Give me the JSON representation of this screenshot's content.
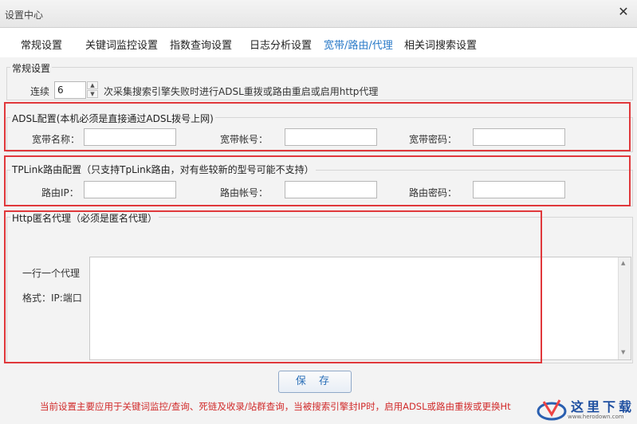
{
  "window": {
    "title": "设置中心",
    "close_icon": "close-icon"
  },
  "tabs": [
    {
      "label": "常规设置"
    },
    {
      "label": "关键词监控设置"
    },
    {
      "label": "指数查询设置"
    },
    {
      "label": "日志分析设置"
    },
    {
      "label": "宽带/路由/代理",
      "active": true
    },
    {
      "label": "相关词搜索设置"
    }
  ],
  "general": {
    "legend": "常规设置",
    "prefix": "连续",
    "count": "6",
    "suffix": "次采集搜索引擎失败时进行ADSL重拨或路由重启或启用http代理"
  },
  "adsl": {
    "legend": "ADSL配置(本机必须是直接通过ADSL拨号上网)",
    "name_label": "宽带名称：",
    "account_label": "宽带帐号：",
    "password_label": "宽带密码：",
    "name_value": "",
    "account_value": "",
    "password_value": ""
  },
  "router": {
    "legend": "TPLink路由配置（只支持TpLink路由，对有些较新的型号可能不支持）",
    "ip_label": "路由IP：",
    "account_label": "路由帐号：",
    "password_label": "路由密码：",
    "ip_value": "",
    "account_value": "",
    "password_value": ""
  },
  "proxy": {
    "legend": "Http匿名代理（必须是匿名代理）",
    "hint1": "一行一个代理",
    "hint2": "格式：IP:端口",
    "value": ""
  },
  "actions": {
    "save_label": "保 存"
  },
  "footer_note": "当前设置主要应用于关键词监控/查询、死链及收录/站群查询，当被搜索引擎封IP时，启用ADSL或路由重拨或更换Ht",
  "watermark": {
    "text": "这里下载",
    "url": "www.herodown.com"
  },
  "colors": {
    "highlight_box": "#e0383b",
    "active_tab": "#2a7ac8",
    "note": "#d12b2b"
  }
}
